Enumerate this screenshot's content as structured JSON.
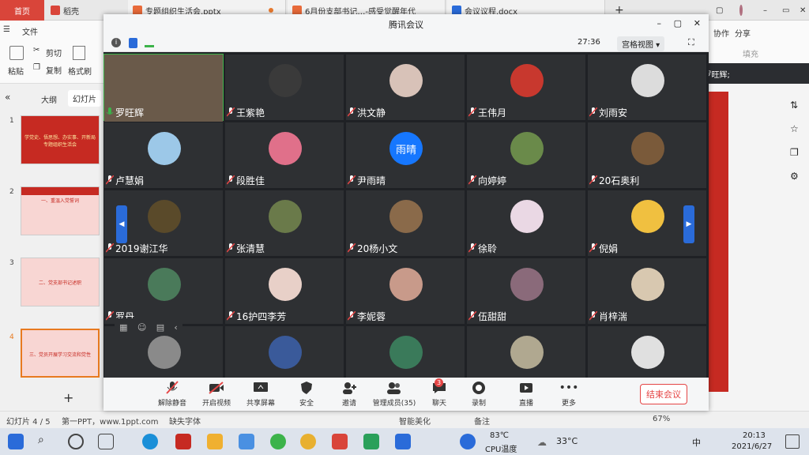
{
  "wps_tabs": {
    "home": "首页",
    "app": "稻壳",
    "doc1": "专题组织生活会.pptx",
    "doc2": "6月份支部书记…-感受觉醒年代",
    "doc3": "会议议程.docx",
    "add": "+"
  },
  "ribbon": {
    "file": "文件",
    "cut": "剪切",
    "copy": "复制",
    "paste": "粘贴",
    "format_painter": "格式刷",
    "collab": "协作",
    "share": "分享",
    "fill": "填充"
  },
  "left_panel": {
    "outline_tab": "大纲",
    "slides_tab": "幻灯片",
    "add": "+",
    "slides": [
      {
        "num": "1",
        "text": "学党史、悟思想、办实事、开新局 专题组织生活会"
      },
      {
        "num": "2",
        "text": "一、重温入党誓词"
      },
      {
        "num": "3",
        "text": "二、党支部书记述职"
      },
      {
        "num": "4",
        "text": "三、党员开展学习交流和党性"
      }
    ]
  },
  "status_bar": {
    "slide_count": "幻灯片 4 / 5",
    "theme": "第一PPT，www.1ppt.com",
    "font_missing": "缺失字体",
    "beautify": "智能美化",
    "notes": "备注",
    "zoom": "67%"
  },
  "meeting": {
    "title": "腾讯会议",
    "timer": "27:36",
    "view_mode": "宫格视图",
    "speaking_label": "正在讲话: 罗旺辉;",
    "participants": [
      {
        "name": "罗旺辉",
        "avatar": "#6a5a4a"
      },
      {
        "name": "王紫艳",
        "avatar": "#3a3a3a"
      },
      {
        "name": "洪文静",
        "avatar": "#d8c2b8"
      },
      {
        "name": "王伟月",
        "avatar": "#c8382e"
      },
      {
        "name": "刘雨安",
        "avatar": "#dcdcdc"
      },
      {
        "name": "卢慧娟",
        "avatar": "#9cc8e8"
      },
      {
        "name": "段胜佳",
        "avatar": "#e0708a"
      },
      {
        "name": "尹雨晴",
        "avatar": "#1677ff",
        "initial": "雨晴"
      },
      {
        "name": "向婷婷",
        "avatar": "#6a8a4a"
      },
      {
        "name": "20石奥利",
        "avatar": "#7a5a3a"
      },
      {
        "name": "2019谢江华",
        "avatar": "#5a4a2a"
      },
      {
        "name": "张清慧",
        "avatar": "#6a7a4a"
      },
      {
        "name": "20杨小文",
        "avatar": "#8a6a4a"
      },
      {
        "name": "徐聆",
        "avatar": "#ead8e4"
      },
      {
        "name": "倪娟",
        "avatar": "#f0c040"
      },
      {
        "name": "罗丹",
        "avatar": "#4a7a5a"
      },
      {
        "name": "16护四李芳",
        "avatar": "#e8d0c8"
      },
      {
        "name": "李妮蓉",
        "avatar": "#c89a8a"
      },
      {
        "name": "伍甜甜",
        "avatar": "#8a6a7a"
      },
      {
        "name": "肖梓湍",
        "avatar": "#d8c8b0"
      },
      {
        "name": "",
        "avatar": "#8a8a8a"
      },
      {
        "name": "",
        "avatar": "#3a5a9a"
      },
      {
        "name": "",
        "avatar": "#3a7a5a"
      },
      {
        "name": "",
        "avatar": "#b0a890"
      },
      {
        "name": "",
        "avatar": "#e0e0e0"
      }
    ],
    "toolbar": {
      "unmute": "解除静音",
      "video": "开启视频",
      "share": "共享屏幕",
      "security": "安全",
      "invite": "邀请",
      "manage": "管理成员(35)",
      "chat": "聊天",
      "chat_badge": "3",
      "record": "录制",
      "live": "直播",
      "more": "更多",
      "end": "结束会议"
    }
  },
  "taskbar": {
    "temp": "83℃",
    "cpu": "CPU温度",
    "weather": "33°C",
    "ime": "中",
    "time": "20:13",
    "date": "2021/6/27"
  }
}
